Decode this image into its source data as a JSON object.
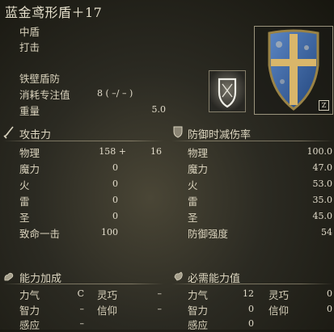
{
  "item": {
    "name": "蓝金鸢形盾＋17",
    "type": "中盾",
    "attack_type": "打击",
    "skill": "铁壁盾防",
    "fp_cost_label": "消耗专注值",
    "fp_cost_value": "8 (  –/  – )",
    "weight_label": "重量",
    "weight_value": "5.0",
    "corner_glyph": "Z"
  },
  "attack": {
    "title": "攻击力",
    "rows": [
      {
        "label": "物理",
        "value": "158 +",
        "extra": "16"
      },
      {
        "label": "魔力",
        "value": "0",
        "extra": ""
      },
      {
        "label": "火",
        "value": "0",
        "extra": ""
      },
      {
        "label": "雷",
        "value": "0",
        "extra": ""
      },
      {
        "label": "圣",
        "value": "0",
        "extra": ""
      },
      {
        "label": "致命一击",
        "value": "100",
        "extra": ""
      }
    ]
  },
  "defense": {
    "title": "防御时减伤率",
    "rows": [
      {
        "label": "物理",
        "value": "100.0"
      },
      {
        "label": "魔力",
        "value": "47.0"
      },
      {
        "label": "火",
        "value": "53.0"
      },
      {
        "label": "雷",
        "value": "35.0"
      },
      {
        "label": "圣",
        "value": "45.0"
      },
      {
        "label": "防御强度",
        "value": "54"
      }
    ]
  },
  "scaling": {
    "title": "能力加成",
    "rows": [
      {
        "a_label": "力气",
        "a_value": "C",
        "b_label": "灵巧",
        "b_value": "–"
      },
      {
        "a_label": "智力",
        "a_value": "–",
        "b_label": "信仰",
        "b_value": "–"
      },
      {
        "a_label": "感应",
        "a_value": "–",
        "b_label": "",
        "b_value": ""
      }
    ]
  },
  "requirements": {
    "title": "必需能力值",
    "rows": [
      {
        "a_label": "力气",
        "a_value": "12",
        "b_label": "灵巧",
        "b_value": "0"
      },
      {
        "a_label": "智力",
        "a_value": "0",
        "b_label": "信仰",
        "b_value": "0"
      },
      {
        "a_label": "感应",
        "a_value": "0",
        "b_label": "",
        "b_value": ""
      }
    ]
  },
  "icons": {
    "attack": "sword-icon",
    "defense": "shield-icon",
    "scaling": "arm-icon",
    "requirements": "hand-icon",
    "skill": "skill-icon",
    "item": "kite-shield-icon"
  }
}
